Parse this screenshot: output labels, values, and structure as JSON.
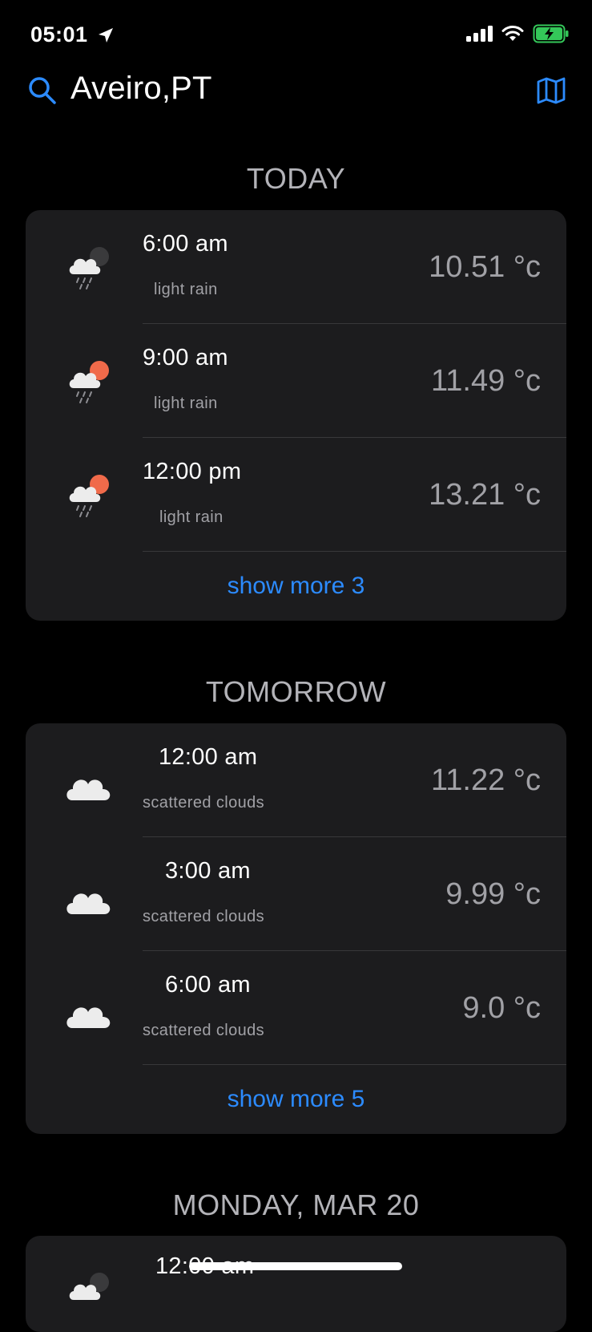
{
  "status": {
    "time": "05:01"
  },
  "header": {
    "city": "Aveiro,PT"
  },
  "colors": {
    "accent": "#2c8bff",
    "card_bg": "#1c1c1e",
    "sun": "#f06a4a"
  },
  "sections": [
    {
      "title": "TODAY",
      "rows": [
        {
          "time": "6:00 am",
          "desc": "light rain",
          "temp": "10.51 °c",
          "icon": "night-rain-cloud-icon"
        },
        {
          "time": "9:00 am",
          "desc": "light rain",
          "temp": "11.49 °c",
          "icon": "day-rain-cloud-icon"
        },
        {
          "time": "12:00 pm",
          "desc": "light rain",
          "temp": "13.21 °c",
          "icon": "day-rain-cloud-icon"
        }
      ],
      "show_more": "show more 3"
    },
    {
      "title": "TOMORROW",
      "rows": [
        {
          "time": "12:00 am",
          "desc": "scattered clouds",
          "temp": "11.22 °c",
          "icon": "cloud-icon"
        },
        {
          "time": "3:00 am",
          "desc": "scattered clouds",
          "temp": "9.99 °c",
          "icon": "cloud-icon"
        },
        {
          "time": "6:00 am",
          "desc": "scattered clouds",
          "temp": "9.0 °c",
          "icon": "cloud-icon"
        }
      ],
      "show_more": "show more 5"
    },
    {
      "title": "MONDAY, MAR 20",
      "rows": [
        {
          "time": "12:00 am",
          "desc": "",
          "temp": "",
          "icon": "night-cloud-icon"
        }
      ]
    }
  ]
}
